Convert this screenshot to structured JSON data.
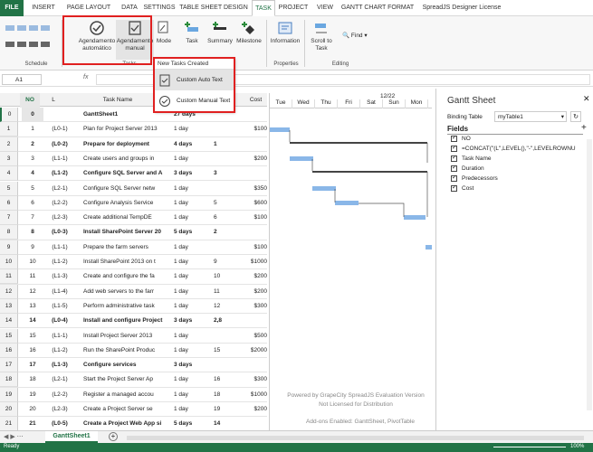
{
  "tabs": [
    "FILE",
    "INSERT",
    "PAGE LAYOUT",
    "DATA",
    "SETTINGS",
    "TABLE SHEET DESIGN",
    "TASK",
    "PROJECT",
    "VIEW",
    "GANTT CHART FORMAT",
    "SpreadJS Designer License"
  ],
  "ribbon": {
    "auto_label": "Agendamento automático",
    "manual_label": "Agendamento manual",
    "mode_label": "Mode",
    "task_label": "Task",
    "summary_label": "Summary",
    "milestone_label": "Milestone",
    "information_label": "Information",
    "scroll_label": "Scroll to Task",
    "find_label": "Find",
    "group_schedule": "Schedule",
    "group_tasks": "Tasks",
    "group_properties": "Properties",
    "group_editing": "Editing"
  },
  "dropdown": {
    "header": "New Tasks Created",
    "items": [
      "Custom Auto Text",
      "Custom Manual Text"
    ]
  },
  "formula": {
    "namebox": "A1",
    "fx": "fx"
  },
  "columns": {
    "no": "NO",
    "l": "L",
    "taskname": "Task Name",
    "cost": "Cost"
  },
  "rows": [
    {
      "n": "0",
      "no": "0",
      "lvl": "",
      "name": "GanttSheet1",
      "dur": "27 days",
      "pred": "",
      "cost": "",
      "bold": true
    },
    {
      "n": "1",
      "no": "1",
      "lvl": "(L0-1)",
      "name": "Plan for Project Server 2013",
      "dur": "1 day",
      "pred": "",
      "cost": "$100"
    },
    {
      "n": "2",
      "no": "2",
      "lvl": "(L0-2)",
      "name": "Prepare for deployment",
      "dur": "4 days",
      "pred": "1",
      "cost": "",
      "bold": true
    },
    {
      "n": "3",
      "no": "3",
      "lvl": "(L1-1)",
      "name": "Create users and groups in",
      "dur": "1 day",
      "pred": "",
      "cost": "$200"
    },
    {
      "n": "4",
      "no": "4",
      "lvl": "(L1-2)",
      "name": "Configure SQL Server and A",
      "dur": "3 days",
      "pred": "3",
      "cost": "",
      "bold": true
    },
    {
      "n": "5",
      "no": "5",
      "lvl": "(L2-1)",
      "name": "Configure SQL Server netw",
      "dur": "1 day",
      "pred": "",
      "cost": "$350"
    },
    {
      "n": "6",
      "no": "6",
      "lvl": "(L2-2)",
      "name": "Configure Analysis Service",
      "dur": "1 day",
      "pred": "5",
      "cost": "$600"
    },
    {
      "n": "7",
      "no": "7",
      "lvl": "(L2-3)",
      "name": "Create additional TempDE",
      "dur": "1 day",
      "pred": "6",
      "cost": "$100"
    },
    {
      "n": "8",
      "no": "8",
      "lvl": "(L0-3)",
      "name": "Install SharePoint Server 20",
      "dur": "5 days",
      "pred": "2",
      "cost": "",
      "bold": true
    },
    {
      "n": "9",
      "no": "9",
      "lvl": "(L1-1)",
      "name": "Prepare the farm servers",
      "dur": "1 day",
      "pred": "",
      "cost": "$100"
    },
    {
      "n": "10",
      "no": "10",
      "lvl": "(L1-2)",
      "name": "Install SharePoint 2013 on t",
      "dur": "1 day",
      "pred": "9",
      "cost": "$1000"
    },
    {
      "n": "11",
      "no": "11",
      "lvl": "(L1-3)",
      "name": "Create and configure the fa",
      "dur": "1 day",
      "pred": "10",
      "cost": "$200"
    },
    {
      "n": "12",
      "no": "12",
      "lvl": "(L1-4)",
      "name": "Add web servers to the farr",
      "dur": "1 day",
      "pred": "11",
      "cost": "$200"
    },
    {
      "n": "13",
      "no": "13",
      "lvl": "(L1-5)",
      "name": "Perform administrative task",
      "dur": "1 day",
      "pred": "12",
      "cost": "$300"
    },
    {
      "n": "14",
      "no": "14",
      "lvl": "(L0-4)",
      "name": "Install and configure Project",
      "dur": "3 days",
      "pred": "2,8",
      "cost": "",
      "bold": true
    },
    {
      "n": "15",
      "no": "15",
      "lvl": "(L1-1)",
      "name": "Install Project Server 2013",
      "dur": "1 day",
      "pred": "",
      "cost": "$500"
    },
    {
      "n": "16",
      "no": "16",
      "lvl": "(L1-2)",
      "name": "Run the SharePoint Produc",
      "dur": "1 day",
      "pred": "15",
      "cost": "$2000"
    },
    {
      "n": "17",
      "no": "17",
      "lvl": "(L1-3)",
      "name": "Configure services",
      "dur": "3 days",
      "pred": "",
      "cost": "",
      "bold": true
    },
    {
      "n": "18",
      "no": "18",
      "lvl": "(L2-1)",
      "name": "Start the Project Server Ap",
      "dur": "1 day",
      "pred": "16",
      "cost": "$300"
    },
    {
      "n": "19",
      "no": "19",
      "lvl": "(L2-2)",
      "name": "Register a managed accou",
      "dur": "1 day",
      "pred": "18",
      "cost": "$1000"
    },
    {
      "n": "20",
      "no": "20",
      "lvl": "(L2-3)",
      "name": "Create a Project Server se",
      "dur": "1 day",
      "pred": "19",
      "cost": "$200"
    },
    {
      "n": "21",
      "no": "21",
      "lvl": "(L0-5)",
      "name": "Create a Project Web App si",
      "dur": "5 days",
      "pred": "14",
      "cost": "",
      "bold": true
    },
    {
      "n": "22",
      "no": "22",
      "lvl": "(L1-1)",
      "name": "Deploy Project Web App si",
      "dur": "",
      "pred": "",
      "cost": "",
      "bold": true
    }
  ],
  "gantt": {
    "date": "12/22",
    "days": [
      "Tue",
      "Wed",
      "Thu",
      "Fri",
      "Sat",
      "Sun",
      "Mon"
    ],
    "watermark1": "Powered by GrapeCity SpreadJS Evaluation Version",
    "watermark2": "Not Licensed for Distribution",
    "addons": "Add-ons Enabled: GanttSheet, PivotTable"
  },
  "panel": {
    "title": "Gantt Sheet",
    "binding_label": "Binding Table",
    "binding_value": "myTable1",
    "fields_label": "Fields",
    "fields": [
      "NO",
      "=CONCAT(\"(L\",LEVEL(),\"-\",LEVELROWNU",
      "Task Name",
      "Duration",
      "Predecessors",
      "Cost"
    ]
  },
  "sheet": {
    "tab": "GanttSheet1"
  },
  "status": {
    "ready": "Ready",
    "zoom": "100%"
  },
  "colors": {
    "accent": "#217346",
    "highlight": "#e02020",
    "bar": "#8ab7e8"
  }
}
